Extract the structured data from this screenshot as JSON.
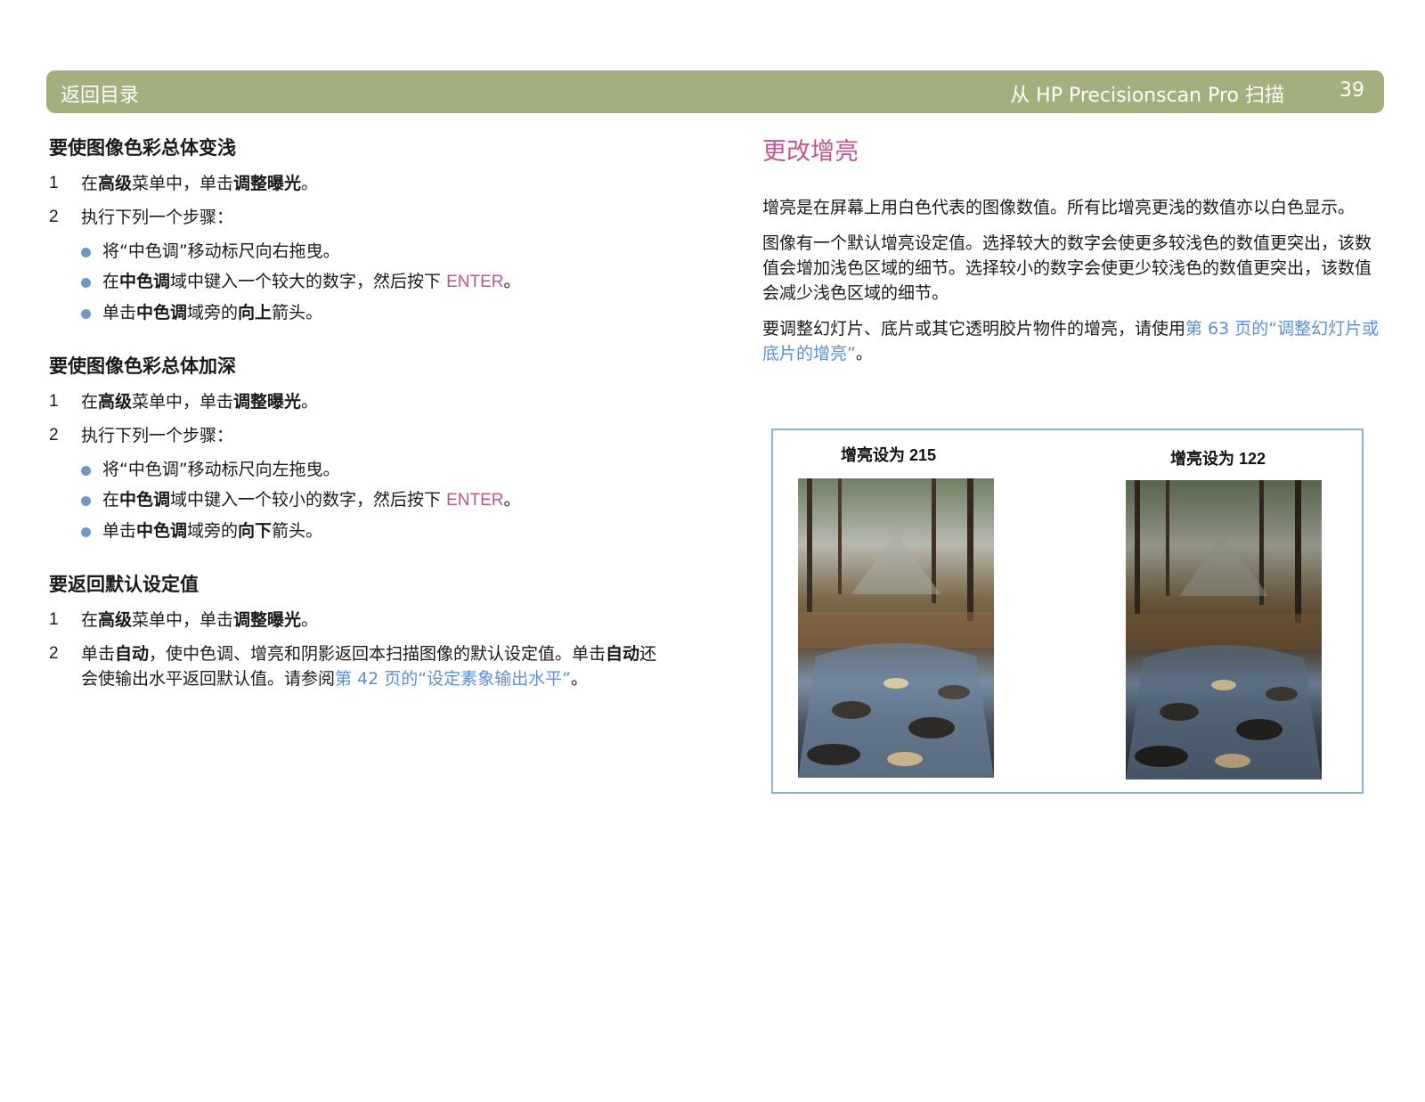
{
  "header": {
    "back_label": "返回目录",
    "title": "从 HP Precisionscan Pro 扫描",
    "page_number": "39"
  },
  "left": {
    "sections": [
      {
        "title": "要使图像色彩总体变浅",
        "steps": [
          {
            "num": "1",
            "parts": [
              "在",
              "高级",
              "菜单中，单击",
              "调整曝光",
              "。"
            ]
          },
          {
            "num": "2",
            "text": "执行下列一个步骤："
          }
        ],
        "bullets": [
          {
            "text": "将“中色调”移动标尺向右拖曳。"
          },
          {
            "parts": [
              "在",
              "中色调",
              "域中键入一个较大的数字，然后按下 ",
              "ENTER",
              "。"
            ]
          },
          {
            "parts": [
              "单击",
              "中色调",
              "域旁的",
              "向上",
              "箭头。"
            ]
          }
        ]
      },
      {
        "title": "要使图像色彩总体加深",
        "steps": [
          {
            "num": "1",
            "parts": [
              "在",
              "高级",
              "菜单中，单击",
              "调整曝光",
              "。"
            ]
          },
          {
            "num": "2",
            "text": "执行下列一个步骤："
          }
        ],
        "bullets": [
          {
            "text": "将“中色调”移动标尺向左拖曳。"
          },
          {
            "parts": [
              "在",
              "中色调",
              "域中键入一个较小的数字，然后按下 ",
              "ENTER",
              "。"
            ]
          },
          {
            "parts": [
              "单击",
              "中色调",
              "域旁的",
              "向下",
              "箭头。"
            ]
          }
        ]
      },
      {
        "title": "要返回默认设定值",
        "steps": [
          {
            "num": "1",
            "parts": [
              "在",
              "高级",
              "菜单中，单击",
              "调整曝光",
              "。"
            ]
          },
          {
            "num": "2",
            "parts": [
              "单击",
              "自动",
              "，使中色调、增亮和阴影返回本扫描图像的默认设定值。单击",
              "自动",
              "还会使输出水平返回默认值。请参阅",
              "第 42 页的“设定素象输出水平”",
              "。"
            ]
          }
        ]
      }
    ]
  },
  "right": {
    "title": "更改增亮",
    "para1": "增亮是在屏幕上用白色代表的图像数值。所有比增亮更浅的数值亦以白色显示。",
    "para2": "图像有一个默认增亮设定值。选择较大的数字会使更多较浅色的数值更突出，该数值会增加浅色区域的细节。选择较小的数字会使更少较浅色的数值更突出，该数值会减少浅色区域的细节。",
    "para3_text": "要调整幻灯片、底片或其它透明胶片物件的增亮，请使用",
    "para3_link": "第 63 页的“调整幻灯片或底片的增亮”",
    "para3_end": "。"
  },
  "figure": {
    "caption_left": "增亮设为 215",
    "caption_right": "增亮设为 122"
  },
  "colors": {
    "header_bg": "#a3b07e",
    "accent_pink": "#c0568f",
    "link_blue": "#5b8fd2",
    "bullet_blue": "#6e98c8",
    "figure_border": "#8eb0d8"
  }
}
